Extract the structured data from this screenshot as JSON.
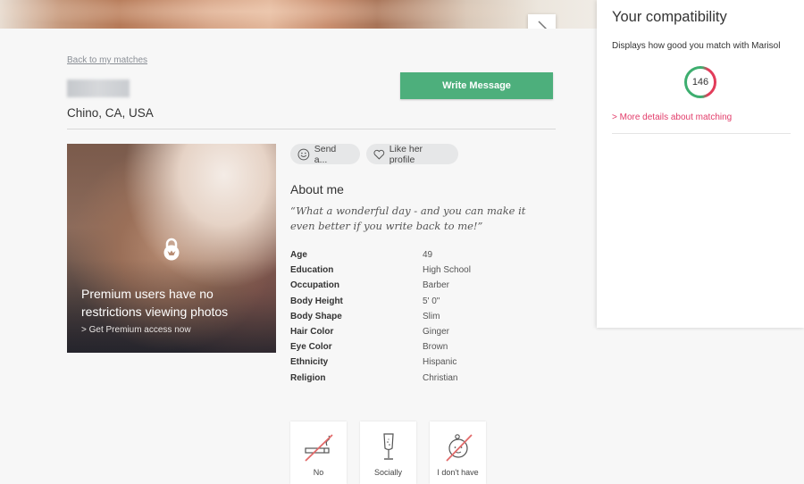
{
  "hero": {
    "next_icon": "chevron-right-icon"
  },
  "profile": {
    "back_link": "Back to my matches",
    "location": "Chino, CA, USA",
    "write_message": "Write Message"
  },
  "photo": {
    "lock_icon": "premium-lock-icon",
    "premium_text": "Premium users have no restrictions viewing photos",
    "premium_link": "> Get Premium access now"
  },
  "actions": {
    "send": "Send a...",
    "like": "Like her profile"
  },
  "about": {
    "title": "About me",
    "quote": "“What a wonderful day - and you can make it even better if you write back to me!”",
    "attributes": [
      {
        "label": "Age",
        "value": "49"
      },
      {
        "label": "Education",
        "value": "High School"
      },
      {
        "label": "Occupation",
        "value": "Barber"
      },
      {
        "label": "Body Height",
        "value": "5' 0\""
      },
      {
        "label": "Body Shape",
        "value": "Slim"
      },
      {
        "label": "Hair Color",
        "value": "Ginger"
      },
      {
        "label": "Eye Color",
        "value": "Brown"
      },
      {
        "label": "Ethnicity",
        "value": "Hispanic"
      },
      {
        "label": "Religion",
        "value": "Christian"
      }
    ]
  },
  "lifestyle": [
    {
      "icon": "no-smoking-icon",
      "label": "No"
    },
    {
      "icon": "champagne-glass-icon",
      "label": "Socially"
    },
    {
      "icon": "no-children-icon",
      "label": "I don't have"
    }
  ],
  "compatibility": {
    "title": "Your compatibility",
    "subtitle": "Displays how good you match with Marisol",
    "score": "146",
    "details_link": "> More details about matching",
    "colors": {
      "green": "#3dae6f",
      "red": "#e23c5a",
      "link": "#e23c6a"
    }
  },
  "colors": {
    "write_button": "#4daf7c"
  }
}
